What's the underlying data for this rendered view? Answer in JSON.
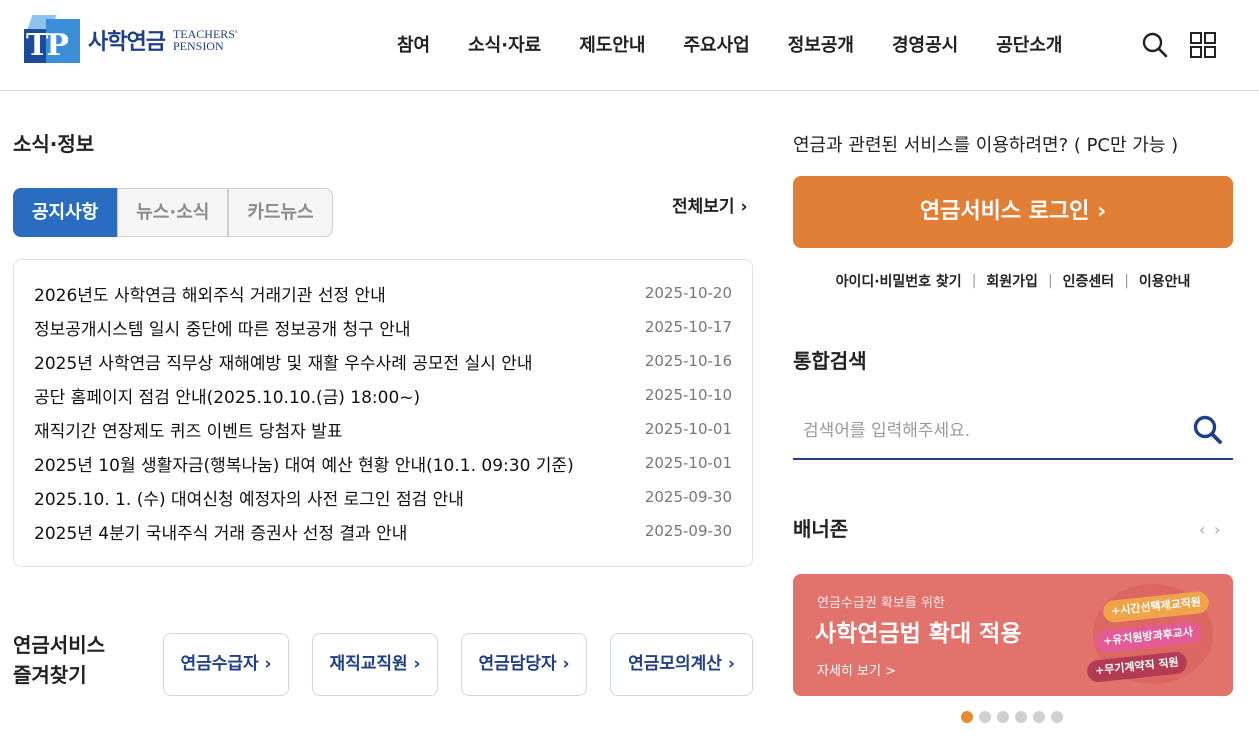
{
  "header": {
    "logo_name": "사학연금",
    "logo_en_line1": "TEACHERS'",
    "logo_en_line2": "PENSION",
    "logo_mark": "TP",
    "nav": [
      "참여",
      "소식·자료",
      "제도안내",
      "주요사업",
      "정보공개",
      "경영공시",
      "공단소개"
    ],
    "icons": [
      "search-icon",
      "grid-menu-icon"
    ]
  },
  "news": {
    "section_title": "소식·정보",
    "tabs": [
      "공지사항",
      "뉴스·소식",
      "카드뉴스"
    ],
    "active_tab": "공지사항",
    "view_all": "전체보기 ›",
    "items": [
      {
        "title": "2026년도 사학연금 해외주식 거래기관 선정 안내",
        "date": "2025-10-20"
      },
      {
        "title": "정보공개시스템 일시 중단에 따른 정보공개 청구 안내",
        "date": "2025-10-17"
      },
      {
        "title": "2025년 사학연금 직무상 재해예방 및 재활 우수사례 공모전 실시 안내",
        "date": "2025-10-16"
      },
      {
        "title": "공단 홈페이지 점검 안내(2025.10.10.(금) 18:00~)",
        "date": "2025-10-10"
      },
      {
        "title": "재직기간 연장제도 퀴즈 이벤트 당첨자 발표",
        "date": "2025-10-01"
      },
      {
        "title": "2025년 10월 생활자금(행복나눔) 대여 예산 현황 안내(10.1. 09:30 기준)",
        "date": "2025-10-01"
      },
      {
        "title": "2025.10. 1. (수) 대여신청 예정자의 사전 로그인 점검 안내",
        "date": "2025-09-30"
      },
      {
        "title": "2025년 4분기 국내주식 거래 증권사 선정 결과 안내",
        "date": "2025-09-30"
      }
    ]
  },
  "favorites": {
    "title_line1": "연금서비스",
    "title_line2": "즐겨찾기",
    "buttons": [
      "연금수급자 ›",
      "재직교직원 ›",
      "연금담당자 ›",
      "연금모의계산 ›"
    ]
  },
  "service": {
    "note": "연금과 관련된 서비스를 이용하려면? ( PC만 가능 )",
    "login_button": "연금서비스 로그인 ›",
    "links": [
      "아이디·비밀번호 찾기",
      "회원가입",
      "인증센터",
      "이용안내"
    ]
  },
  "search": {
    "title": "통합검색",
    "placeholder": "검색어를 입력해주세요.",
    "value": ""
  },
  "banner_zone": {
    "title": "배너존",
    "prev": "‹",
    "next": "›",
    "banner": {
      "sub": "연금수급권 확보를 위한",
      "main": "사학연금법 확대 적용",
      "more": "자세히 보기 >",
      "tags": [
        "+시간선택제교직원",
        "+유치원방과후교사",
        "+무기계약직 직원"
      ]
    },
    "dots_count": 6,
    "active_dot": 1
  },
  "colors": {
    "primary_blue": "#2a6cc0",
    "navy": "#1f3f86",
    "login_orange": "#e27f36",
    "banner_red": "#e2726c",
    "dot_active": "#e58a2e"
  }
}
